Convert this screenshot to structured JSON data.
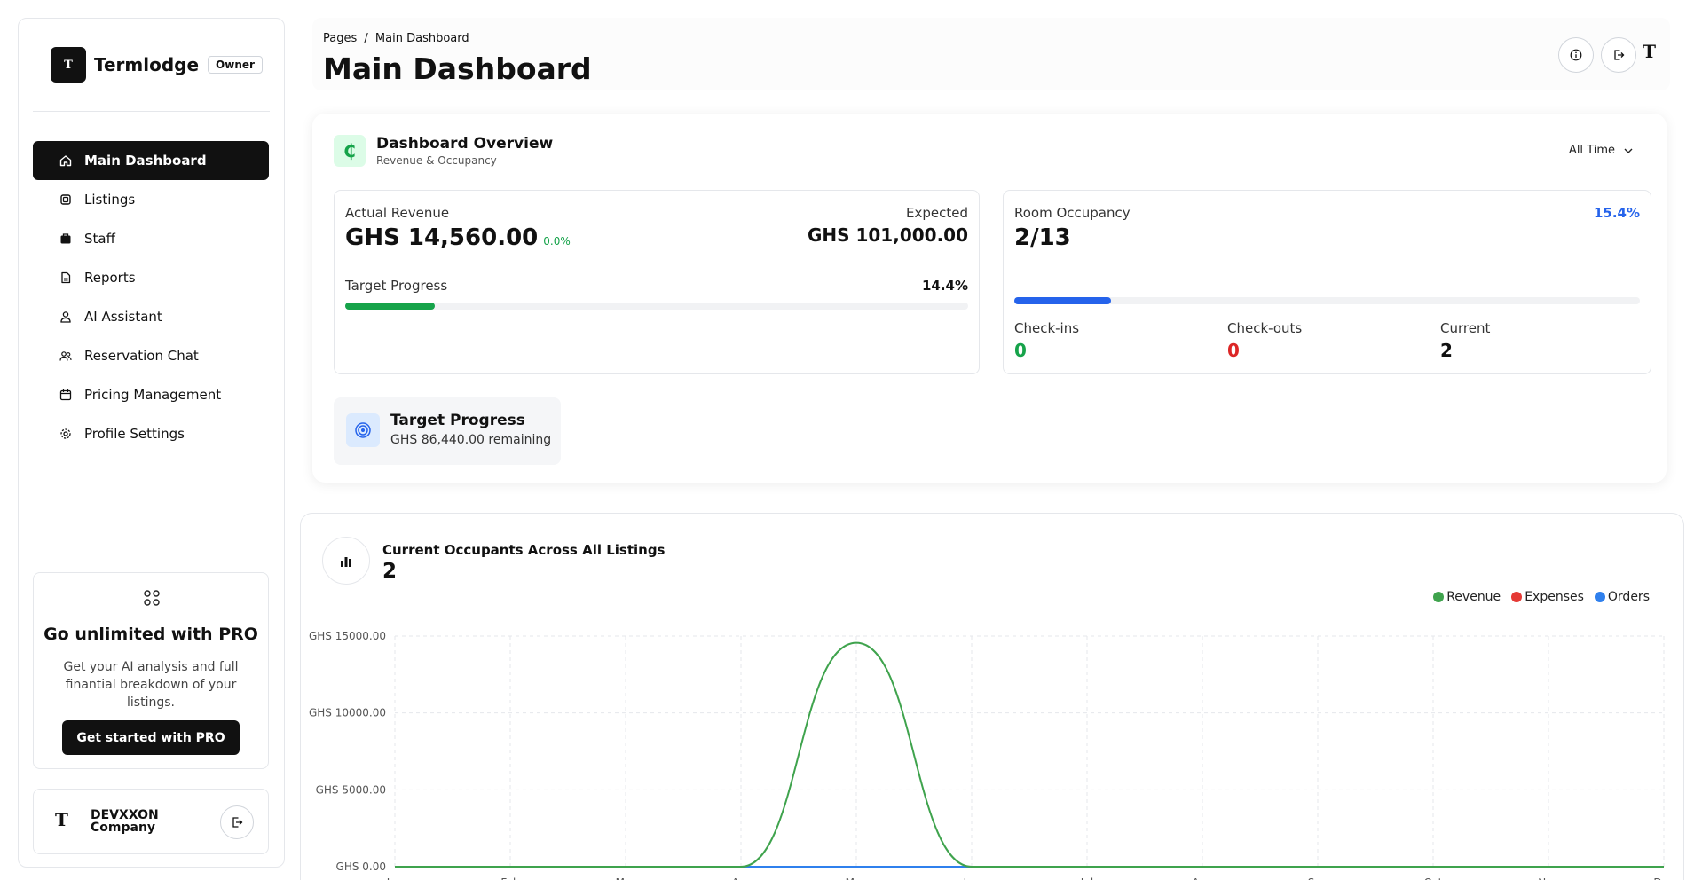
{
  "sidebar": {
    "brand": {
      "logo": "T",
      "name": "Termlodge",
      "badge": "Owner"
    },
    "items": [
      {
        "label": "Main Dashboard",
        "icon": "home-icon",
        "active": true
      },
      {
        "label": "Listings",
        "icon": "listings-icon"
      },
      {
        "label": "Staff",
        "icon": "staff-icon"
      },
      {
        "label": "Reports",
        "icon": "file-icon"
      },
      {
        "label": "AI Assistant",
        "icon": "user-icon"
      },
      {
        "label": "Reservation Chat",
        "icon": "users-icon"
      },
      {
        "label": "Pricing Management",
        "icon": "calendar-icon"
      },
      {
        "label": "Profile Settings",
        "icon": "gear-icon"
      }
    ],
    "pro": {
      "title": "Go unlimited with PRO",
      "text": "Get your AI analysis and full finantial breakdown of your listings.",
      "button": "Get started with PRO"
    },
    "user": {
      "avatar": "T",
      "name": "DEVXXON Company"
    }
  },
  "header": {
    "breadcrumb_root": "Pages",
    "breadcrumb_sep": "/",
    "breadcrumb_current": "Main Dashboard",
    "title": "Main Dashboard",
    "avatar": "T"
  },
  "overview": {
    "icon": "₵",
    "title": "Dashboard Overview",
    "subtitle": "Revenue & Occupancy",
    "filter": "All Time",
    "revenue": {
      "actual_label": "Actual Revenue",
      "actual_value": "GHS 14,560.00",
      "change": "0.0%",
      "expected_label": "Expected",
      "expected_value": "GHS 101,000.00",
      "target_label": "Target Progress",
      "target_pct": "14.4%",
      "target_fraction": 0.144
    },
    "occupancy": {
      "label": "Room Occupancy",
      "pct": "15.4%",
      "value": "2/13",
      "fraction": 0.154,
      "checkins_label": "Check-ins",
      "checkins_value": "0",
      "checkouts_label": "Check-outs",
      "checkouts_value": "0",
      "current_label": "Current",
      "current_value": "2"
    },
    "target_card": {
      "title": "Target Progress",
      "remaining": "GHS 86,440.00 remaining"
    }
  },
  "colors": {
    "green": "#16a34a",
    "red": "#dc2626",
    "blue": "#2563eb",
    "revenue": "#3fa34d",
    "expenses": "#e53935",
    "orders": "#2f80ed"
  },
  "occupants": {
    "title": "Current Occupants Across All Listings",
    "value": "2"
  },
  "chart_data": {
    "type": "line",
    "title": "",
    "xlabel": "",
    "ylabel": "",
    "categories": [
      "Jan",
      "Feb",
      "Mar",
      "Apr",
      "May",
      "Jun",
      "Jul",
      "Aug",
      "Sep",
      "Oct",
      "Nov",
      "Dec"
    ],
    "y_ticks": [
      "GHS 0.00",
      "GHS 5000.00",
      "GHS 10000.00",
      "GHS 15000.00"
    ],
    "y_tick_values": [
      0,
      5000,
      10000,
      15000
    ],
    "ylim": [
      0,
      15000
    ],
    "grid": true,
    "legend_position": "top-right",
    "series": [
      {
        "name": "Revenue",
        "color": "#3fa34d",
        "values": [
          0,
          0,
          0,
          0,
          14560,
          0,
          0,
          0,
          0,
          0,
          0,
          0
        ]
      },
      {
        "name": "Expenses",
        "color": "#e53935",
        "values": [
          0,
          0,
          0,
          0,
          0,
          0,
          0,
          0,
          0,
          0,
          0,
          0
        ]
      },
      {
        "name": "Orders",
        "color": "#2f80ed",
        "values": [
          0,
          0,
          0,
          0,
          0,
          0,
          0,
          0,
          0,
          0,
          0,
          0
        ]
      }
    ]
  }
}
